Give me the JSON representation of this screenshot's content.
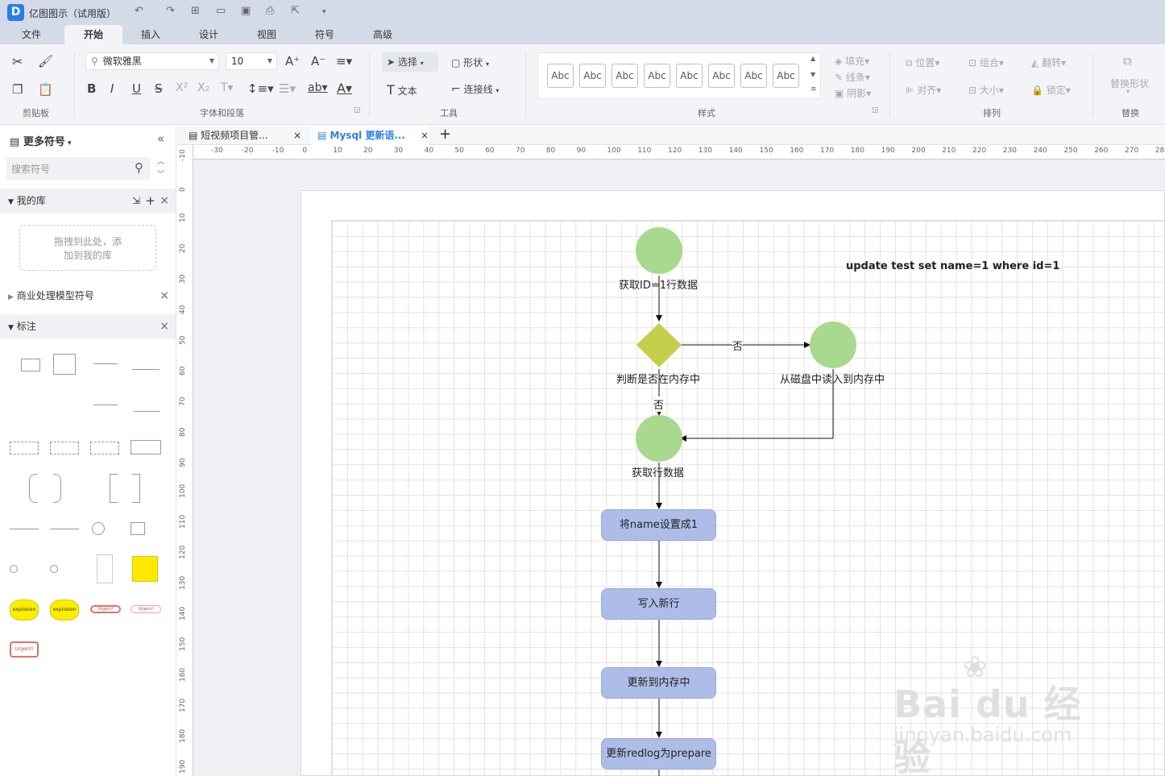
{
  "app": {
    "title": "亿图图示（试用版）",
    "logo": "D"
  },
  "menu": [
    "文件",
    "开始",
    "插入",
    "设计",
    "视图",
    "符号",
    "高级"
  ],
  "ribbon": {
    "font_name": "微软雅黑",
    "font_size": "10",
    "select_label": "选择",
    "shape_label": "形状",
    "text_label": "文本",
    "connector_label": "连接线",
    "style_sample": "Abc",
    "fill_label": "填充",
    "line_label": "线条",
    "shadow_label": "阴影",
    "position_label": "位置",
    "group_label": "组合",
    "flip_label": "翻转",
    "align_label": "对齐",
    "size_label": "大小",
    "lock_label": "锁定",
    "replace_label": "替换形状",
    "groups": {
      "clipboard": "剪贴板",
      "font": "字体和段落",
      "tools": "工具",
      "styles": "样式",
      "arrange": "排列",
      "replace": "替换"
    }
  },
  "sidebar": {
    "title": "更多符号",
    "search_placeholder": "搜索符号",
    "my_library": "我的库",
    "drop_hint_1": "拖拽到此处，添",
    "drop_hint_2": "加到我的库",
    "lib_business": "商业处理模型符号",
    "lib_callout": "标注",
    "callout_samples": {
      "explosion": "explosion",
      "urgent": "Urgent!"
    }
  },
  "tabs": [
    {
      "label": "短视频项目管..."
    },
    {
      "label": "Mysql 更新语..."
    }
  ],
  "ruler": {
    "h_ticks": [
      "-30",
      "-20",
      "-10",
      "0",
      "10",
      "20",
      "30",
      "40",
      "50",
      "60",
      "70",
      "80",
      "90",
      "100",
      "110",
      "120",
      "130",
      "140",
      "150",
      "160",
      "170",
      "180",
      "190",
      "200",
      "210",
      "220",
      "230",
      "240",
      "250",
      "260",
      "270",
      "280"
    ],
    "v_ticks": [
      "-10",
      "0",
      "10",
      "20",
      "30",
      "40",
      "50",
      "60",
      "70",
      "80",
      "90",
      "100",
      "110",
      "120",
      "130",
      "140",
      "150",
      "160",
      "170",
      "180",
      "190"
    ]
  },
  "diagram": {
    "sql": "update test set name=1 where id=1",
    "n1": "获取ID=1行数据",
    "decision": "判断是否在内存中",
    "disk": "从磁盘中读入到内存中",
    "fetch": "获取行数据",
    "edge_no_right": "否",
    "edge_no_down": "否",
    "p1": "将name设置成1",
    "p2": "写入新行",
    "p3": "更新到内存中",
    "p4": "更新redlog为prepare",
    "colors": {
      "circle": "#a8d98f",
      "diamond": "#c3cf4a",
      "process": "#aebde8"
    }
  },
  "watermark": {
    "brand": "Bai du 经验",
    "url": "jingyan.baidu.com"
  }
}
